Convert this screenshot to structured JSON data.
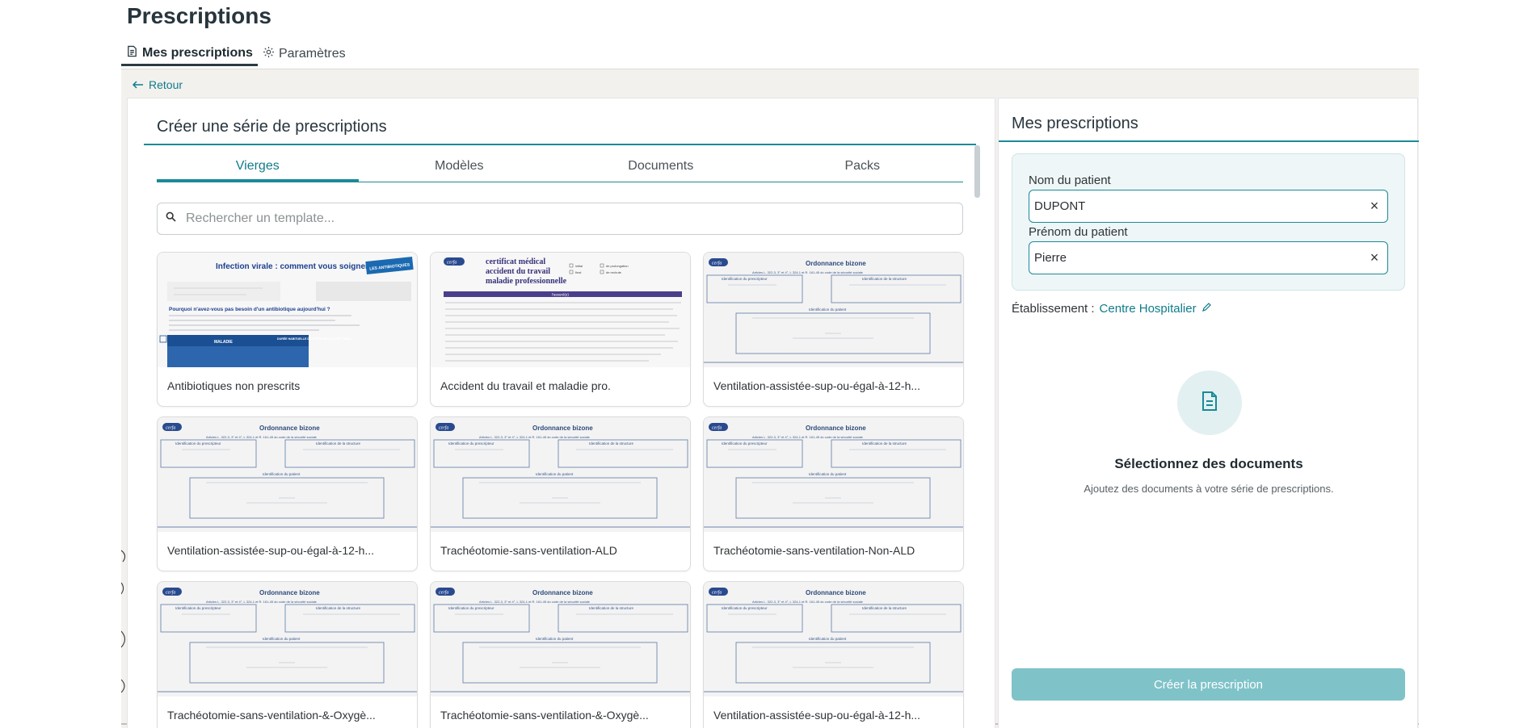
{
  "page": {
    "title": "Prescriptions"
  },
  "top_tabs": [
    {
      "label": "Mes prescriptions",
      "icon": "document-icon",
      "active": true
    },
    {
      "label": "Paramètres",
      "icon": "gear-icon",
      "active": false
    }
  ],
  "back": {
    "label": "Retour"
  },
  "left_panel": {
    "title": "Créer une série de prescriptions",
    "tabs": [
      {
        "label": "Vierges",
        "active": true
      },
      {
        "label": "Modèles",
        "active": false
      },
      {
        "label": "Documents",
        "active": false
      },
      {
        "label": "Packs",
        "active": false
      }
    ],
    "search": {
      "placeholder": "Rechercher un template...",
      "value": ""
    },
    "templates": [
      {
        "label": "Antibiotiques non prescrits",
        "thumb": "infection",
        "thumb_text": {
          "title": "Infection virale : comment vous soigner ?",
          "badge": "LES ANTIBIOTIQUES",
          "question": "Pourquoi n'avez-vous pas besoin d'un antibiotique aujourd'hui ?",
          "col_a": "MALADIE",
          "col_b": "DURÉE HABITUELLE DES PRINCIPAUX SYMPTÔMES"
        }
      },
      {
        "label": "Accident du travail et maladie pro.",
        "thumb": "certificat",
        "thumb_text": {
          "title": "certificat médical",
          "line2": "accident du travail",
          "line3": "maladie professionnelle",
          "opt1": "initial",
          "opt2": "de prolongation",
          "opt3": "final",
          "opt4": "de rechute",
          "band": "l'assuré(e)"
        }
      },
      {
        "label": "Ventilation-assistée-sup-ou-égal-à-12-h...",
        "thumb": "bizone"
      },
      {
        "label": "Ventilation-assistée-sup-ou-égal-à-12-h...",
        "thumb": "bizone"
      },
      {
        "label": "Trachéotomie-sans-ventilation-ALD",
        "thumb": "bizone"
      },
      {
        "label": "Trachéotomie-sans-ventilation-Non-ALD",
        "thumb": "bizone"
      },
      {
        "label": "Trachéotomie-sans-ventilation-&-Oxygè...",
        "thumb": "bizone"
      },
      {
        "label": "Trachéotomie-sans-ventilation-&-Oxygè...",
        "thumb": "bizone"
      },
      {
        "label": "Ventilation-assistée-sup-ou-égal-à-12-h...",
        "thumb": "bizone"
      }
    ],
    "bizone_thumb_text": {
      "logo": "cerfa",
      "title": "Ordonnance bizone",
      "articles": "Articles L. 322-3, 3° et 4°, L 324-1 et R. 161-45 du code de la sécurité sociale",
      "box_a": "Identification du prescripteur",
      "box_b": "Identification de la structure",
      "box_c": "Identification du patient"
    }
  },
  "right_panel": {
    "title": "Mes prescriptions",
    "last_name_label": "Nom du patient",
    "last_name_value": "DUPONT",
    "first_name_label": "Prénom du patient",
    "first_name_value": "Pierre",
    "establishment_label": "Établissement :",
    "establishment_value": "Centre Hospitalier",
    "empty_title": "Sélectionnez des documents",
    "empty_subtitle": "Ajoutez des documents à votre série de prescriptions.",
    "create_button": "Créer la prescription"
  },
  "colors": {
    "accent": "#1b8a96",
    "button_disabled": "#7fc3c9",
    "workspace_bg": "#f3f1ee"
  }
}
